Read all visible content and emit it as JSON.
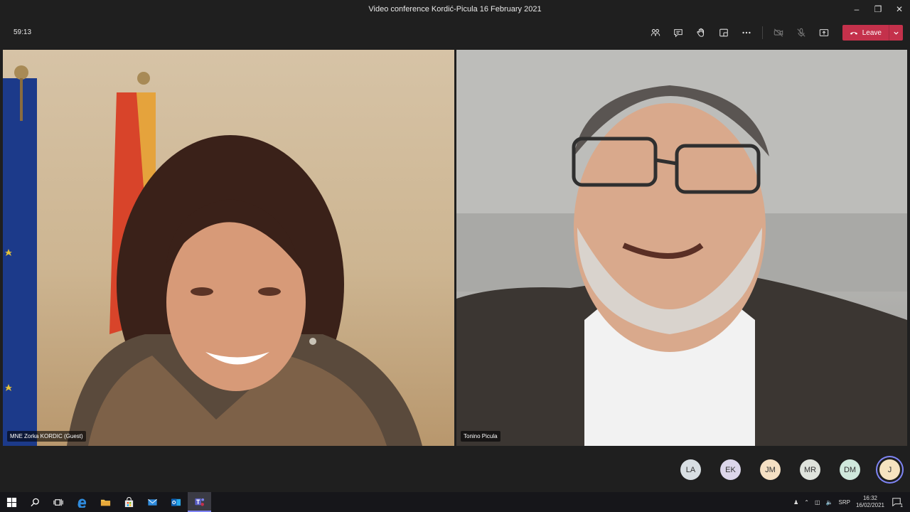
{
  "window": {
    "title": "Video conference Kordić-Picula 16 February 2021"
  },
  "meeting": {
    "timer": "59:13",
    "leave_label": "Leave"
  },
  "participants_video": [
    {
      "name": "MNE Zorka KORDIC (Guest)"
    },
    {
      "name": "Tonino Picula"
    }
  ],
  "roster": [
    {
      "initials": "LA",
      "color": "#d8dfe3"
    },
    {
      "initials": "EK",
      "color": "#dcd6ea"
    },
    {
      "initials": "JM",
      "color": "#f5e0c3"
    },
    {
      "initials": "MR",
      "color": "#dfe3dc"
    },
    {
      "initials": "DM",
      "color": "#cfe8dc"
    },
    {
      "initials": "J",
      "color": "#f6e3c0",
      "active": true
    }
  ],
  "taskbar": {
    "language": "SRP",
    "time": "16:32",
    "date": "16/02/2021",
    "notification_count": "1"
  },
  "colors": {
    "leave_button": "#c4314b",
    "accent": "#7f85f5"
  }
}
